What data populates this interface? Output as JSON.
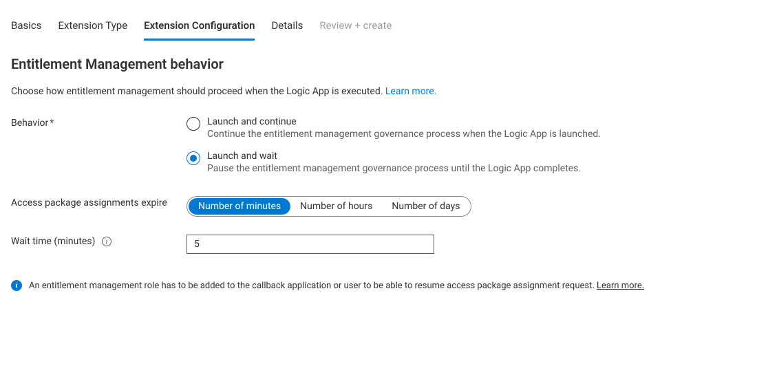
{
  "tabs": {
    "basics": "Basics",
    "extension_type": "Extension Type",
    "extension_configuration": "Extension Configuration",
    "details": "Details",
    "review_create": "Review + create"
  },
  "section": {
    "title": "Entitlement Management behavior",
    "description": "Choose how entitlement management should proceed when the Logic App is executed. ",
    "learn_more": "Learn more."
  },
  "behavior": {
    "label": "Behavior",
    "options": {
      "launch_continue": {
        "label": "Launch and continue",
        "desc": "Continue the entitlement management governance process when the Logic App is launched."
      },
      "launch_wait": {
        "label": "Launch and wait",
        "desc": "Pause the entitlement management governance process until the Logic App completes."
      }
    }
  },
  "expire": {
    "label": "Access package assignments expire",
    "options": {
      "minutes": "Number of minutes",
      "hours": "Number of hours",
      "days": "Number of days"
    }
  },
  "wait_time": {
    "label": "Wait time (minutes)",
    "value": "5"
  },
  "banner": {
    "text": "An entitlement management role has to be added to the callback application or user to be able to resume access package assignment request. ",
    "link": "Learn more."
  }
}
